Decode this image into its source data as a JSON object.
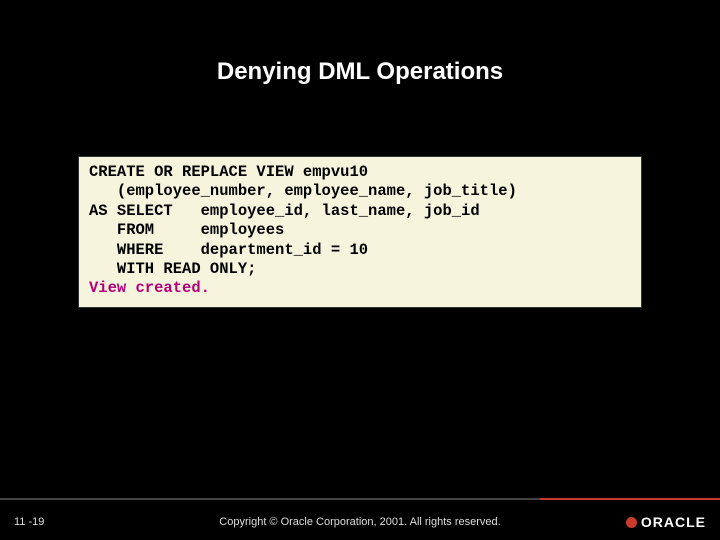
{
  "slide": {
    "title": "Denying DML Operations"
  },
  "code": {
    "lines": [
      "CREATE OR REPLACE VIEW empvu10",
      "   (employee_number, employee_name, job_title)",
      "AS SELECT   employee_id, last_name, job_id",
      "   FROM     employees",
      "   WHERE    department_id = 10",
      "   WITH READ ONLY;"
    ],
    "result": "View created."
  },
  "footer": {
    "page": "11 -19",
    "copyright": "Copyright © Oracle Corporation, 2001. All rights reserved.",
    "brand": "ORACLE"
  }
}
